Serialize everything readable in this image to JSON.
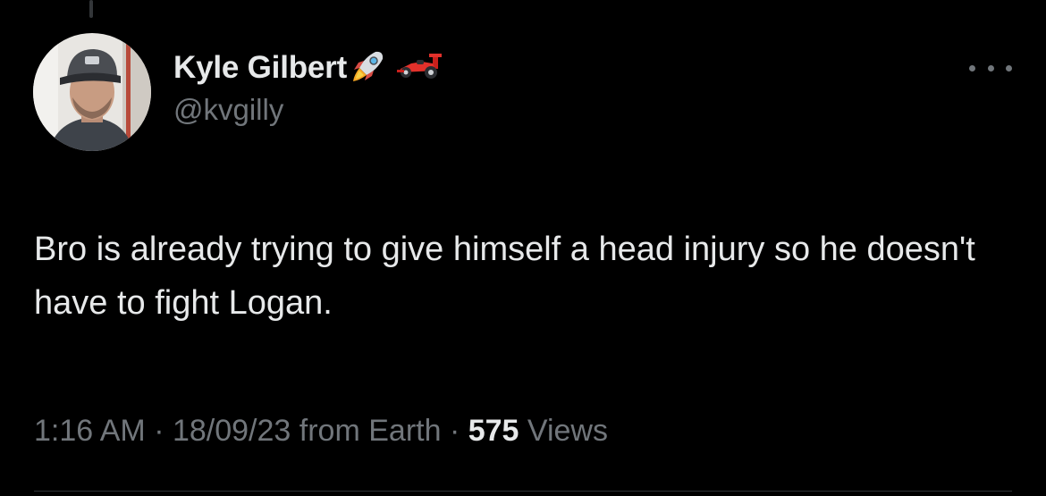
{
  "author": {
    "display_name": "Kyle Gilbert",
    "handle": "@kvgilly",
    "name_emojis": [
      "rocket-emoji",
      "race-car-emoji"
    ]
  },
  "tweet": {
    "text": "Bro is already trying to give himself a head injury so he doesn't have to fight Logan."
  },
  "meta": {
    "time": "1:16 AM",
    "separator": " · ",
    "date": "18/09/23",
    "source": "from Earth",
    "views_count": "575",
    "views_label": "Views"
  },
  "colors": {
    "background": "#000000",
    "primary_text": "#e7e9ea",
    "secondary_text": "#71767b",
    "divider": "#2f3336"
  }
}
